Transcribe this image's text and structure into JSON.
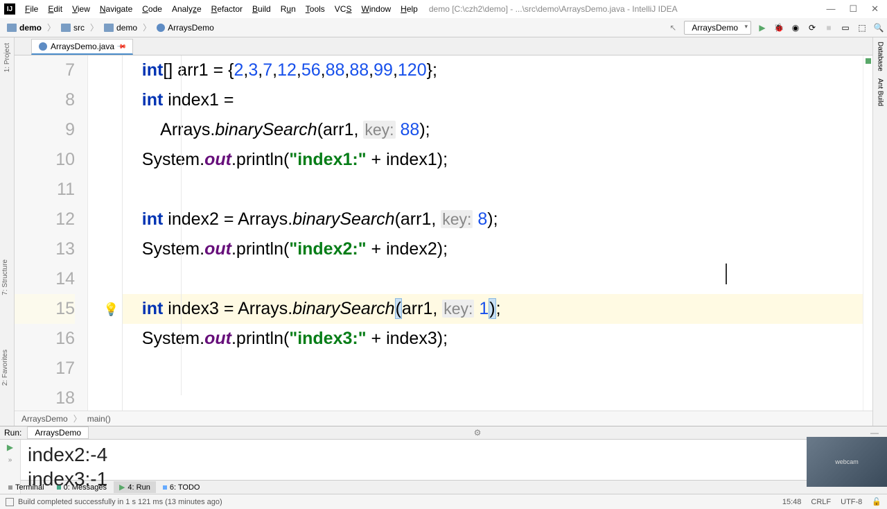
{
  "title": "demo [C:\\czh2\\demo] - ...\\src\\demo\\ArraysDemo.java - IntelliJ IDEA",
  "menu": [
    "File",
    "Edit",
    "View",
    "Navigate",
    "Code",
    "Analyze",
    "Refactor",
    "Build",
    "Run",
    "Tools",
    "VCS",
    "Window",
    "Help"
  ],
  "breadcrumbs": [
    "demo",
    "src",
    "demo",
    "ArraysDemo"
  ],
  "run_config": "ArraysDemo",
  "tab": {
    "name": "ArraysDemo.java"
  },
  "line_start": 7,
  "line_end": 18,
  "highlighted_line": 15,
  "code": {
    "l7": {
      "indent": "        ",
      "arr_vals": [
        2,
        3,
        7,
        12,
        56,
        88,
        88,
        99,
        120
      ]
    },
    "l9_key": 88,
    "l12_key": 8,
    "l15_key": 1
  },
  "bottom_crumb": [
    "ArraysDemo",
    "main()"
  ],
  "run_panel": {
    "label": "Run:",
    "tab": "ArraysDemo",
    "out1": "index2:-4",
    "out2": "index3:-1"
  },
  "bottom_tabs": {
    "terminal": "Terminal",
    "messages": "0: Messages",
    "run": "4: Run",
    "todo": "6: TODO"
  },
  "status": {
    "msg": "Build completed successfully in 1 s 121 ms (13 minutes ago)",
    "pos": "15:48",
    "le": "CRLF",
    "enc": "UTF-8"
  },
  "left_tools": {
    "project": "1: Project",
    "structure": "7: Structure",
    "favorites": "2: Favorites"
  },
  "right_tools": {
    "db": "Database",
    "ant": "Ant Build"
  }
}
